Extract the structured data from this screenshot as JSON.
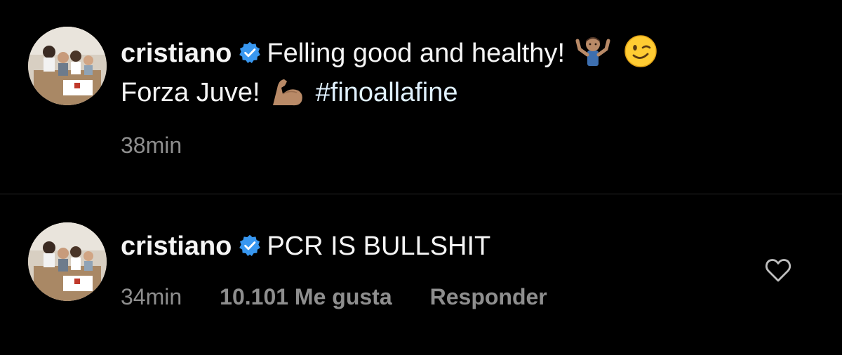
{
  "post": {
    "username": "cristiano",
    "line1": "Felling good and healthy!",
    "line2": "Forza Juve!",
    "hashtag": "#finoallafine",
    "time": "38min",
    "emojis": [
      "shrug-emoji",
      "wink-emoji",
      "flexed-biceps-emoji"
    ]
  },
  "comment": {
    "username": "cristiano",
    "text": "PCR IS BULLSHIT",
    "time": "34min",
    "likes": "10.101 Me gusta",
    "reply": "Responder"
  },
  "icons": {
    "verified": "verified-badge-icon",
    "like": "heart-icon"
  },
  "colors": {
    "background": "#000000",
    "primary_text": "#f5f5f5",
    "secondary_text": "#8e8e8e",
    "verified": "#3897f0",
    "hashtag": "#e0f1ff",
    "divider": "#262626"
  }
}
